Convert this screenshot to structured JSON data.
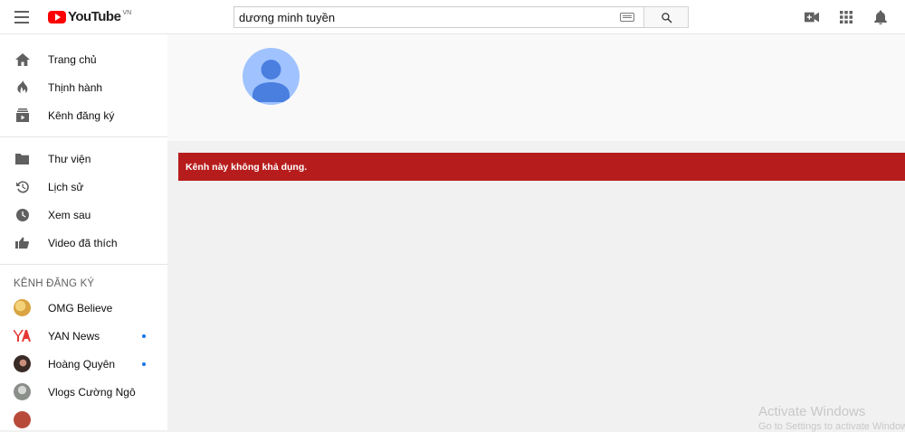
{
  "header": {
    "logo_text": "YouTube",
    "logo_country": "VN",
    "search": {
      "value": "dương minh tuyền",
      "placeholder": "Tìm kiếm"
    }
  },
  "sidebar": {
    "main_items": [
      {
        "label": "Trang chủ",
        "icon": "home-icon"
      },
      {
        "label": "Thịnh hành",
        "icon": "fire-icon"
      },
      {
        "label": "Kênh đăng ký",
        "icon": "subscriptions-icon"
      }
    ],
    "library_items": [
      {
        "label": "Thư viện",
        "icon": "folder-icon"
      },
      {
        "label": "Lịch sử",
        "icon": "history-icon"
      },
      {
        "label": "Xem sau",
        "icon": "clock-icon"
      },
      {
        "label": "Video đã thích",
        "icon": "thumbs-up-icon"
      }
    ],
    "subscriptions_title": "KÊNH ĐĂNG KÝ",
    "subscriptions": [
      {
        "name": "OMG Believe",
        "has_new": false,
        "color": "#d9a441"
      },
      {
        "name": "YAN News",
        "has_new": true,
        "color": "#e53935"
      },
      {
        "name": "Hoàng Quyên",
        "has_new": true,
        "color": "#3a2a26"
      },
      {
        "name": "Vlogs Cường Ngô",
        "has_new": false,
        "color": "#8a8f8a"
      }
    ]
  },
  "main": {
    "alert": "Kênh này không khả dụng."
  },
  "watermark": {
    "title": "Activate Windows",
    "subtitle": "Go to Settings to activate Windows."
  },
  "colors": {
    "alert_bg": "#b71c1c",
    "avatar_bg": "#a0c3ff",
    "avatar_fg": "#4285f4",
    "brand_red": "#ff0000"
  }
}
